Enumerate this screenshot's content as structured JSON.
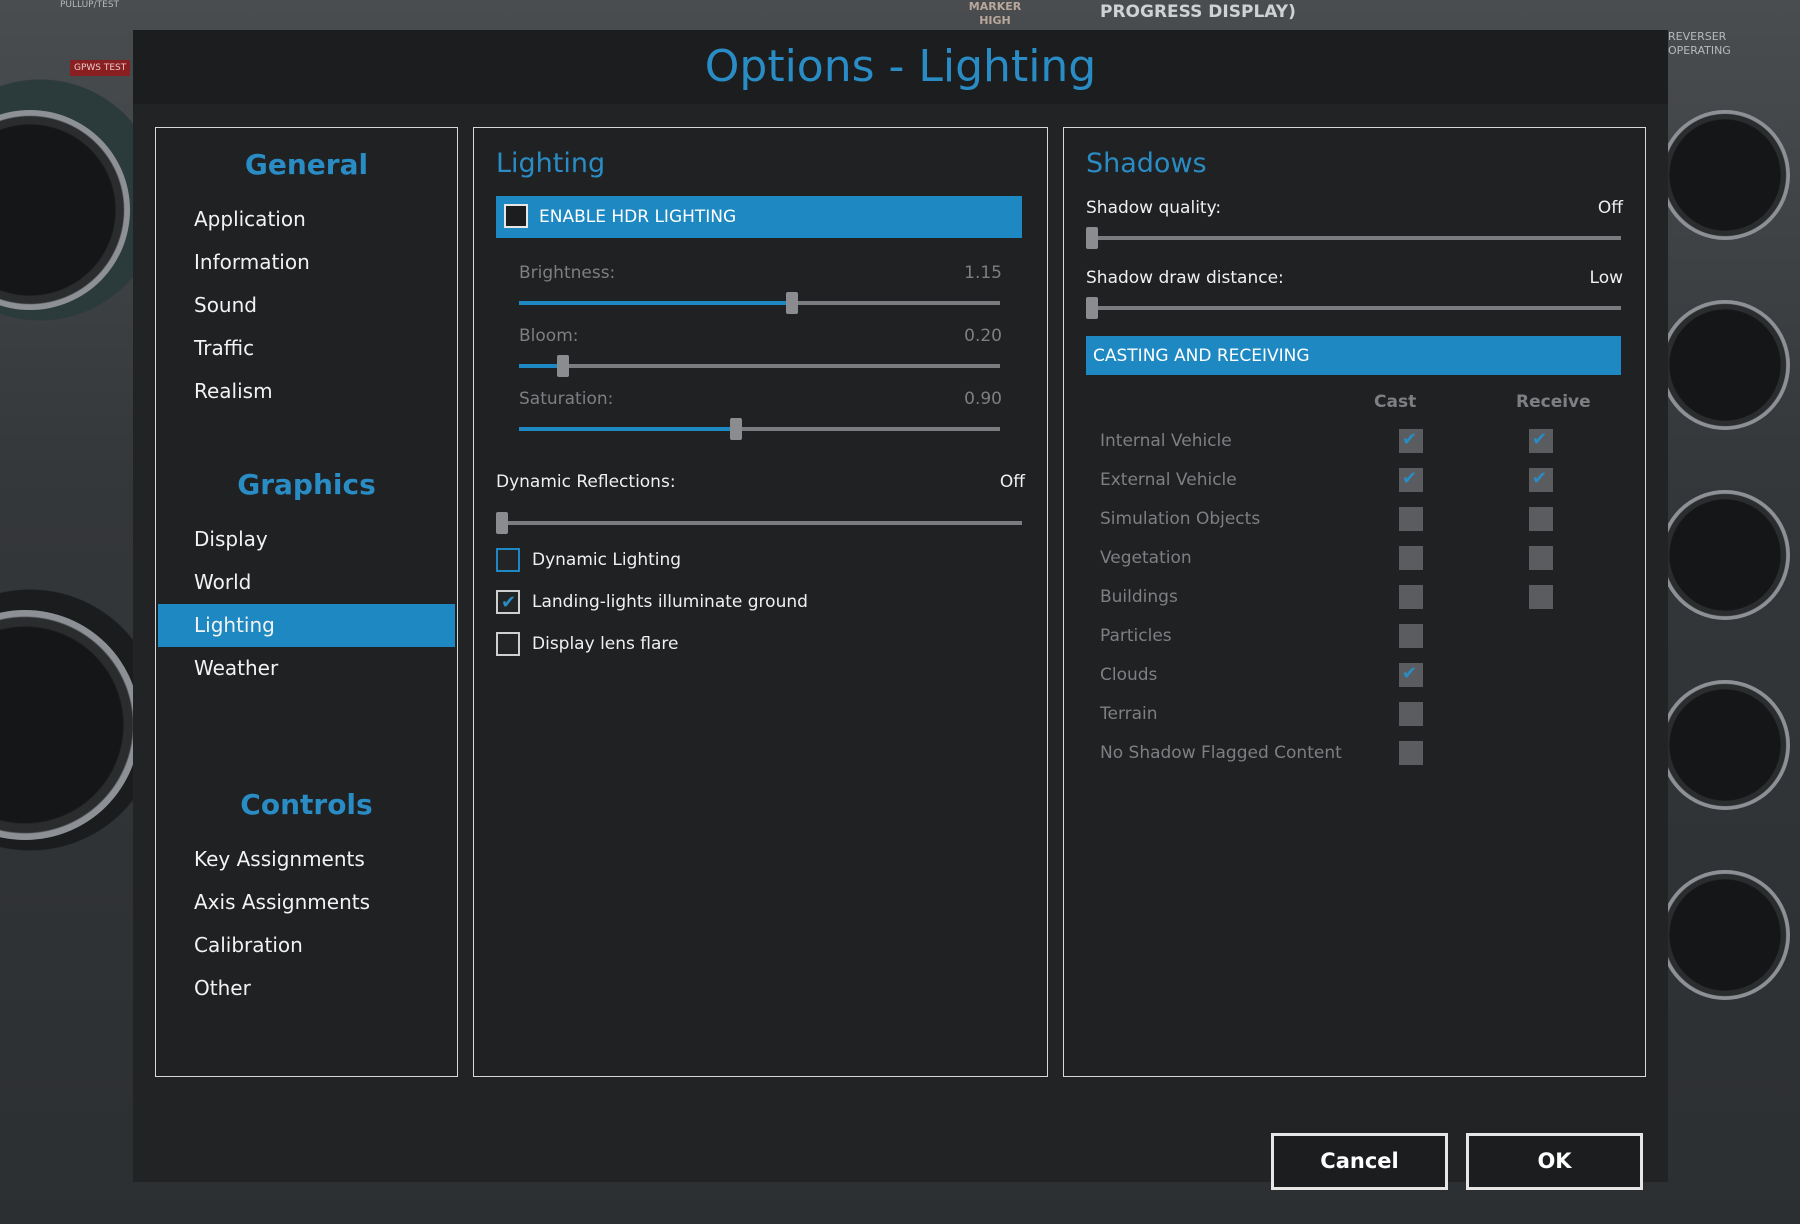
{
  "window": {
    "title": "Options - Lighting"
  },
  "nav": {
    "general": {
      "heading": "General",
      "items": [
        "Application",
        "Information",
        "Sound",
        "Traffic",
        "Realism"
      ]
    },
    "graphics": {
      "heading": "Graphics",
      "items": [
        "Display",
        "World",
        "Lighting",
        "Weather"
      ],
      "active": "Lighting"
    },
    "controls": {
      "heading": "Controls",
      "items": [
        "Key Assignments",
        "Axis Assignments",
        "Calibration",
        "Other"
      ]
    }
  },
  "lighting": {
    "title": "Lighting",
    "hdr": {
      "label": "ENABLE HDR LIGHTING",
      "checked": false
    },
    "brightness": {
      "label": "Brightness:",
      "value": "1.15",
      "fraction": 0.57
    },
    "bloom": {
      "label": "Bloom:",
      "value": "0.20",
      "fraction": 0.08
    },
    "saturation": {
      "label": "Saturation:",
      "value": "0.90",
      "fraction": 0.45
    },
    "reflections": {
      "label": "Dynamic Reflections:",
      "value": "Off",
      "fraction": 0.0
    },
    "options": [
      {
        "label": "Dynamic Lighting",
        "checked": false
      },
      {
        "label": "Landing-lights illuminate ground",
        "checked": true
      },
      {
        "label": "Display lens flare",
        "checked": false
      }
    ]
  },
  "shadows": {
    "title": "Shadows",
    "quality": {
      "label": "Shadow quality:",
      "value": "Off",
      "fraction": 0.0
    },
    "distance": {
      "label": "Shadow draw distance:",
      "value": "Low",
      "fraction": 0.0
    },
    "casting_header": "CASTING AND RECEIVING",
    "col_cast": "Cast",
    "col_receive": "Receive",
    "rows": [
      {
        "label": "Internal Vehicle",
        "cast": true,
        "receive": true
      },
      {
        "label": "External Vehicle",
        "cast": true,
        "receive": true
      },
      {
        "label": "Simulation Objects",
        "cast": false,
        "receive": false
      },
      {
        "label": "Vegetation",
        "cast": false,
        "receive": false
      },
      {
        "label": "Buildings",
        "cast": false,
        "receive": false
      },
      {
        "label": "Particles",
        "cast": false,
        "receive": null
      },
      {
        "label": "Clouds",
        "cast": true,
        "receive": null
      },
      {
        "label": "Terrain",
        "cast": false,
        "receive": null
      },
      {
        "label": "No Shadow Flagged Content",
        "cast": false,
        "receive": null
      }
    ]
  },
  "buttons": {
    "cancel": "Cancel",
    "ok": "OK"
  },
  "background": {
    "labels": [
      "PROGRESS DISPLAY)",
      "MARKER HIGH",
      "GPWS TEST",
      "PULLUP/TEST",
      "REVERSER OPERATING"
    ]
  },
  "colors": {
    "accent": "#1e88c2",
    "title": "#2a8cc4",
    "dialog": "#222325"
  }
}
